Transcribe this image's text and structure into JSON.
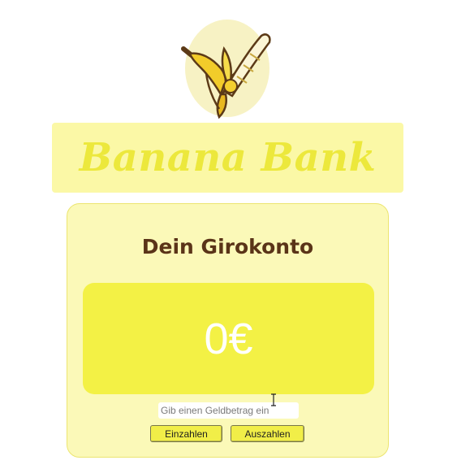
{
  "logo": {
    "icon": "banana-icon"
  },
  "brand": {
    "title": "Banana Bank"
  },
  "account": {
    "title": "Dein Girokonto",
    "balance": "0€"
  },
  "amount_input": {
    "placeholder": "Gib einen Geldbetrag ein",
    "value": ""
  },
  "buttons": {
    "deposit_label": "Einzahlen",
    "withdraw_label": "Auszahlen"
  },
  "colors": {
    "banner_bg": "#fbf8a6",
    "title_text": "#ece83c",
    "card_bg": "#fbf9b8",
    "balance_bg": "#f3f145",
    "heading_text": "#5a3418",
    "button_bg": "#f1ee48"
  }
}
